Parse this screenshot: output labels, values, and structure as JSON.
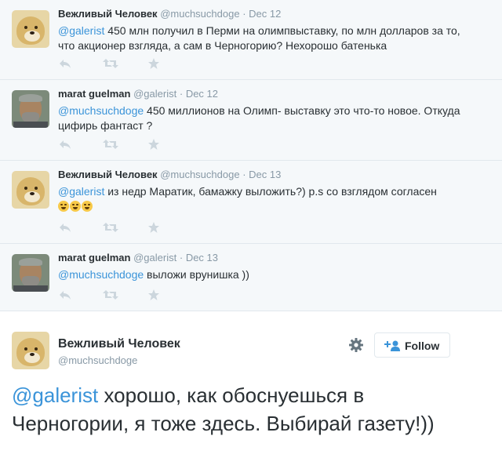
{
  "tweets": [
    {
      "name": "Вежливый Человек",
      "handle": "@muchsuchdoge",
      "time": "Dec 12",
      "mention": "@galerist",
      "text": " 450 млн получил в Перми на олимпвыставку, по млн долларов за то, что акционер взгляда, а сам в Черногорию? Нехорошо батенька"
    },
    {
      "name": "marat guelman",
      "handle": "@galerist",
      "time": "Dec 12",
      "mention": "@muchsuchdoge",
      "text": " 450 миллионов на Олимп- выставку это что-то новое. Откуда цифирь фантаст ?"
    },
    {
      "name": "Вежливый Человек",
      "handle": "@muchsuchdoge",
      "time": "Dec 13",
      "mention": "@galerist",
      "text": " из недр Маратик, бамажку выложить?) p.s со взглядом согласен"
    },
    {
      "name": "marat guelman",
      "handle": "@galerist",
      "time": "Dec 13",
      "mention": "@muchsuchdoge",
      "text": " выложи врунишка ))"
    }
  ],
  "main_tweet": {
    "name": "Вежливый Человек",
    "handle": "@muchsuchdoge",
    "follow_label": "Follow",
    "mention": "@galerist",
    "text": " хорошо, как обоснуешься в Черногории, я тоже здесь. Выбирай газету!))"
  },
  "icons": {
    "reply": "reply-icon",
    "retweet": "retweet-icon",
    "favorite": "star-icon",
    "settings": "gear-icon",
    "follow": "add-user-icon",
    "emoji": "laughing-emoji"
  },
  "colors": {
    "link": "#3b94d9",
    "muted": "#8899a6",
    "thread_bg": "#f5f8fa",
    "divider": "#e1e8ed"
  }
}
